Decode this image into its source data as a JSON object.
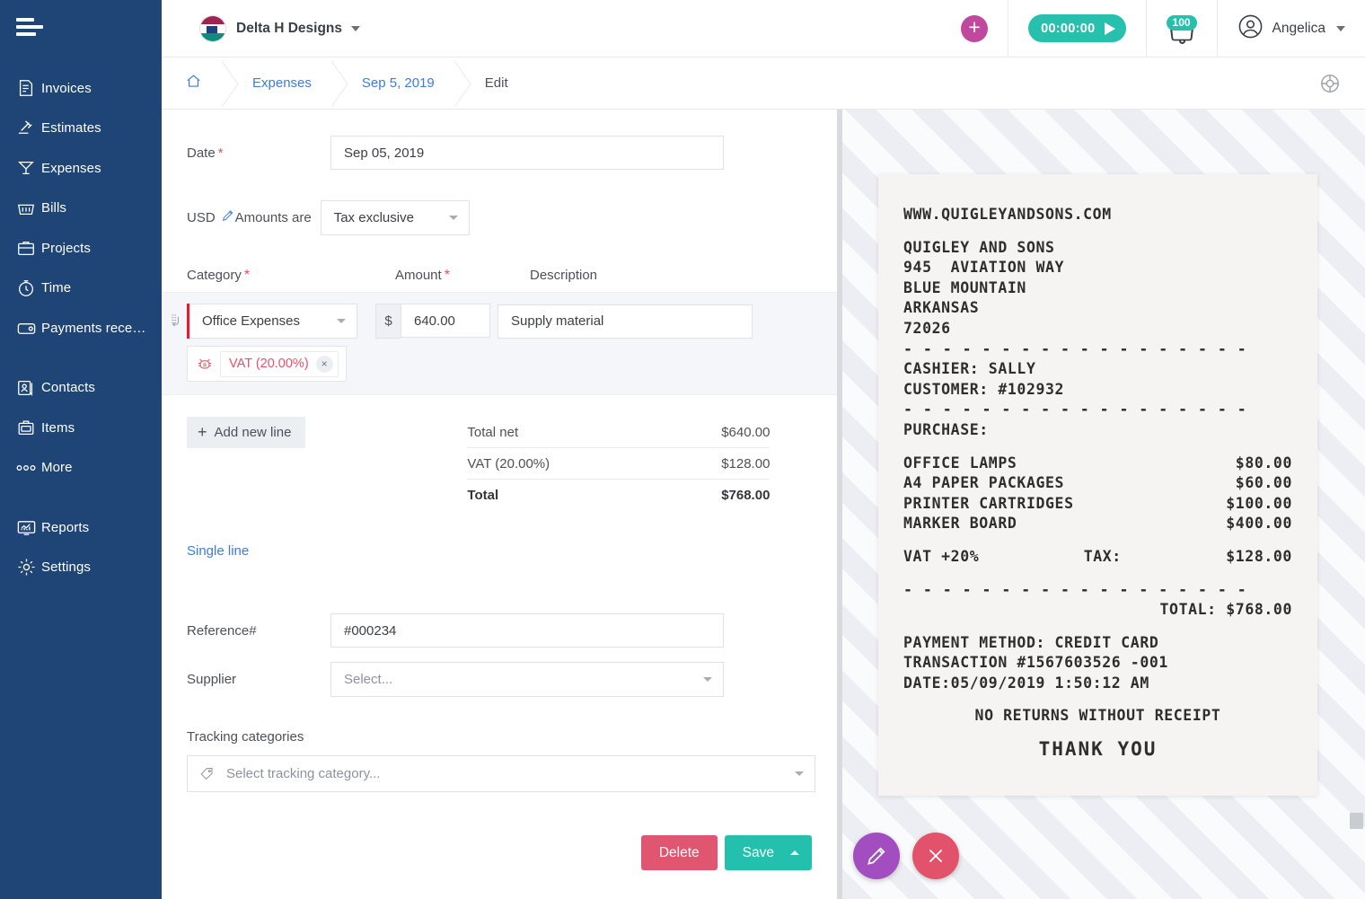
{
  "sidebar": {
    "logo_name": "hamburger-logo",
    "items": [
      {
        "label": "Invoices",
        "icon": "invoice-icon"
      },
      {
        "label": "Estimates",
        "icon": "estimate-icon"
      },
      {
        "label": "Expenses",
        "icon": "expenses-icon"
      },
      {
        "label": "Bills",
        "icon": "bills-icon"
      },
      {
        "label": "Projects",
        "icon": "projects-icon"
      },
      {
        "label": "Time",
        "icon": "time-icon"
      },
      {
        "label": "Payments rece…",
        "icon": "payments-icon"
      },
      {
        "label": "Contacts",
        "icon": "contacts-icon"
      },
      {
        "label": "Items",
        "icon": "items-icon"
      },
      {
        "label": "More",
        "icon": "more-icon"
      },
      {
        "label": "Reports",
        "icon": "reports-icon"
      },
      {
        "label": "Settings",
        "icon": "settings-icon"
      }
    ]
  },
  "header": {
    "org_name": "Delta H Designs",
    "timer": "00:00:00",
    "notification_count": "100",
    "user_name": "Angelica"
  },
  "breadcrumb": {
    "home": "home-icon",
    "items": [
      {
        "label": "Expenses",
        "current": false
      },
      {
        "label": "Sep 5, 2019",
        "current": false
      },
      {
        "label": "Edit",
        "current": true
      }
    ]
  },
  "form": {
    "date_label": "Date",
    "date_value": "Sep 05, 2019",
    "currency": "USD",
    "amounts_are_label": "Amounts are",
    "amounts_are_value": "Tax exclusive",
    "col_category": "Category",
    "col_amount": "Amount",
    "col_description": "Description",
    "line": {
      "category": "Office Expenses",
      "currency_symbol": "$",
      "amount": "640.00",
      "description": "Supply material",
      "tax_chip": "VAT (20.00%)",
      "tax_chip_remove": "×"
    },
    "add_new_line": "Add new line",
    "totals": [
      {
        "label": "Total net",
        "value": "$640.00"
      },
      {
        "label": "VAT (20.00%)",
        "value": "$128.00"
      },
      {
        "label": "Total",
        "value": "$768.00"
      }
    ],
    "single_line": "Single line",
    "reference_label": "Reference#",
    "reference_value": "#000234",
    "supplier_label": "Supplier",
    "supplier_placeholder": "Select...",
    "tracking_label": "Tracking categories",
    "tracking_placeholder": "Select tracking category...",
    "delete_label": "Delete",
    "save_label": "Save"
  },
  "receipt": {
    "website": "WWW.QUIGLEYANDSONS.COM",
    "company": "QUIGLEY AND SONS",
    "address1": "945  AVIATION WAY",
    "address2": "BLUE MOUNTAIN",
    "address3": "ARKANSAS",
    "zip": "72026",
    "divider": "- - - - - - - - - - - - - - - - - -",
    "cashier": "CASHIER: SALLY",
    "customer": "CUSTOMER: #102932",
    "purchase_label": "PURCHASE:",
    "items": [
      {
        "name": "OFFICE LAMPS",
        "price": "$80.00"
      },
      {
        "name": "A4 PAPER PACKAGES",
        "price": "$60.00"
      },
      {
        "name": "PRINTER CARTRIDGES",
        "price": "$100.00"
      },
      {
        "name": "MARKER BOARD",
        "price": "$400.00"
      }
    ],
    "vat_label": "VAT +20%",
    "tax_label": "TAX:",
    "tax_value": "$128.00",
    "total_line": "TOTAL: $768.00",
    "payment_method": "PAYMENT METHOD: CREDIT CARD",
    "transaction": "TRANSACTION #1567603526 -001",
    "date": "DATE:05/09/2019 1:50:12 AM",
    "no_returns": "NO RETURNS WITHOUT RECEIPT",
    "thank_you": "THANK YOU"
  },
  "colors": {
    "sidebar": "#1f4576",
    "accent_teal": "#26c0ad",
    "accent_pink": "#e0556f",
    "accent_purple": "#a34ec0",
    "link_blue": "#3c7be0",
    "required_red": "#e8505b"
  }
}
